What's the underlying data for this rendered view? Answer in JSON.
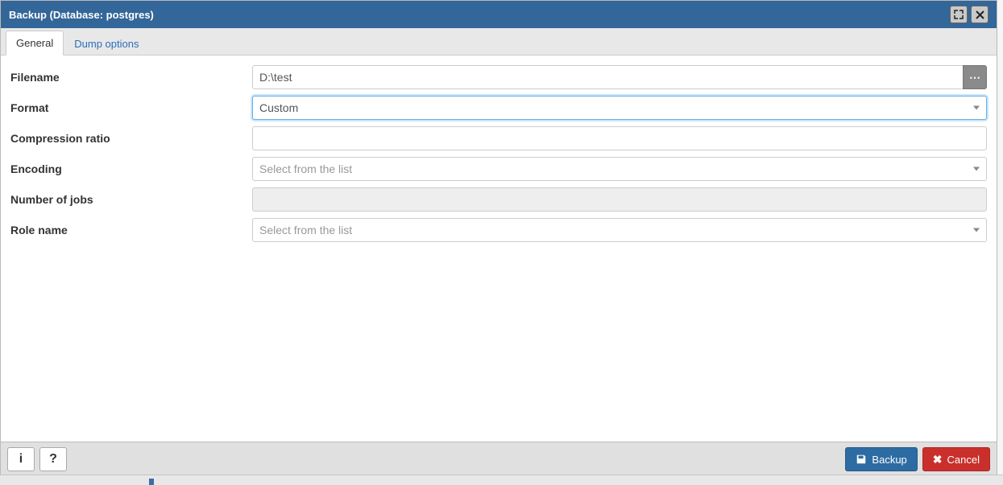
{
  "title": "Backup (Database: postgres)",
  "tabs": [
    {
      "label": "General",
      "active": true
    },
    {
      "label": "Dump options",
      "active": false
    }
  ],
  "fields": {
    "filename": {
      "label": "Filename",
      "value": "D:\\test"
    },
    "format": {
      "label": "Format",
      "value": "Custom"
    },
    "compression": {
      "label": "Compression ratio",
      "value": ""
    },
    "encoding": {
      "label": "Encoding",
      "placeholder": "Select from the list",
      "value": ""
    },
    "jobs": {
      "label": "Number of jobs",
      "value": "",
      "disabled": true
    },
    "role": {
      "label": "Role name",
      "placeholder": "Select from the list",
      "value": ""
    }
  },
  "footer": {
    "info_tooltip": "i",
    "help_tooltip": "?",
    "backup_label": "Backup",
    "cancel_label": "Cancel"
  }
}
